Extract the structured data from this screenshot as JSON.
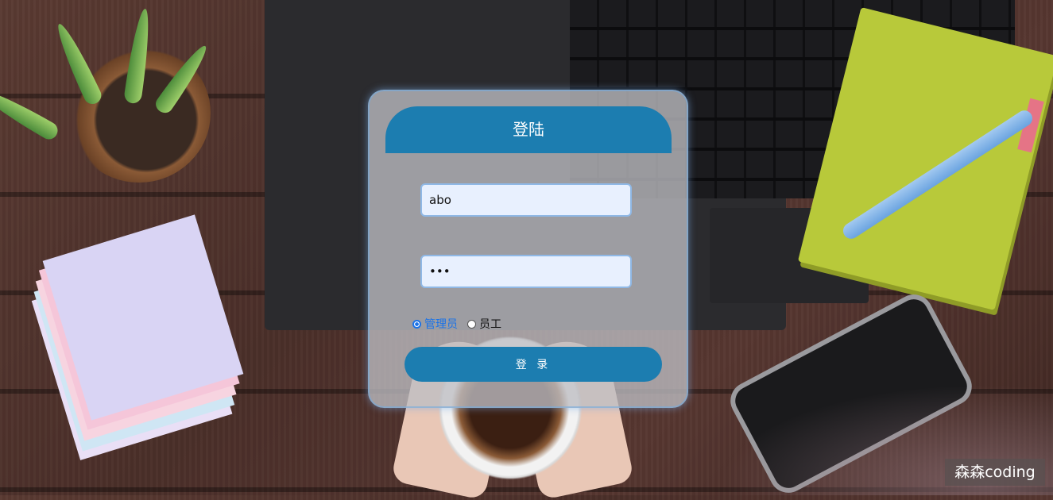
{
  "login": {
    "title": "登陆",
    "username_value": "abo",
    "password_value": "abc",
    "roles": [
      {
        "label": "管理员",
        "selected": true
      },
      {
        "label": "员工",
        "selected": false
      }
    ],
    "submit_label": "登 录"
  },
  "watermark": "森森coding",
  "colors": {
    "accent": "#1c7db0",
    "selected_role": "#1a73e8"
  }
}
